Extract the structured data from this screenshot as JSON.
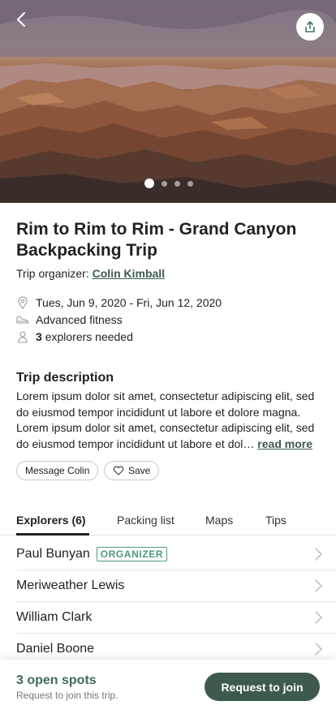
{
  "trip": {
    "title": "Rim to Rim to Rim - Grand Canyon Backpacking Trip",
    "organizer_label": "Trip organizer:",
    "organizer_name": "Colin Kimball",
    "dates": "Tues, Jun 9, 2020 - Fri, Jun 12, 2020",
    "fitness": "Advanced fitness",
    "explorers_count": "3",
    "explorers_needed_text": "explorers needed"
  },
  "hero": {
    "image_count": 4,
    "active_index": 0,
    "back_icon": "chevron-left-icon",
    "share_icon": "share-icon"
  },
  "description": {
    "heading": "Trip description",
    "lines": [
      "Lorem ipsum dolor sit amet, consectetur adipiscing elit, sed",
      "do eiusmod tempor incididunt ut labore et dolore magna.",
      "Lorem ipsum dolor sit amet, consectetur adipiscing elit, sed",
      "do eiusmod tempor incididunt ut labore et dol…"
    ],
    "read_more": "read more"
  },
  "actions": {
    "message": "Message Colin",
    "save": "Save"
  },
  "tabs": [
    {
      "label": "Explorers (6)",
      "active": true
    },
    {
      "label": "Packing list",
      "active": false
    },
    {
      "label": "Maps",
      "active": false
    },
    {
      "label": "Tips",
      "active": false
    }
  ],
  "explorers": [
    {
      "name": "Paul Bunyan",
      "badge": "ORGANIZER"
    },
    {
      "name": "Meriweather Lewis",
      "badge": ""
    },
    {
      "name": "William Clark",
      "badge": ""
    },
    {
      "name": "Daniel Boone",
      "badge": ""
    }
  ],
  "footer": {
    "spots": "3 open spots",
    "sub": "Request to join this trip.",
    "button": "Request to join"
  },
  "colors": {
    "brand": "#3e5a4d",
    "accent_green": "#4e9a7a"
  }
}
